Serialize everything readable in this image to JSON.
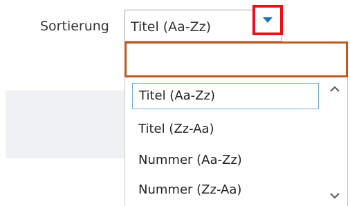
{
  "sort": {
    "label": "Sortierung",
    "selected_value": "Titel (Aa-Zz)",
    "toggle_icon": "caret-down-icon",
    "accent_color": "#1e73be"
  },
  "dropdown": {
    "search_value": "",
    "options": [
      {
        "label": "Titel (Aa-Zz)",
        "selected": true
      },
      {
        "label": "Titel (Zz-Aa)",
        "selected": false
      },
      {
        "label": "Nummer (Aa-Zz)",
        "selected": false
      },
      {
        "label": "Nummer (Zz-Aa)",
        "selected": false
      }
    ],
    "scroll_up_icon": "chevron-up-icon",
    "scroll_down_icon": "chevron-down-icon"
  },
  "colors": {
    "toggle_highlight": "#e8131a",
    "search_highlight": "#c0591d",
    "selected_option_border": "#7aaedb"
  }
}
